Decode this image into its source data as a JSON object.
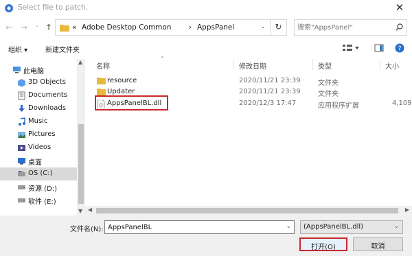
{
  "window": {
    "title": "Select file to patch.",
    "close_glyph": "✕"
  },
  "nav": {
    "back_glyph": "←",
    "forward_glyph": "→",
    "recent_glyph": "⌄",
    "up_glyph": "↑",
    "address": {
      "overflow": "«",
      "crumb1": "Adobe Desktop Common",
      "sep": "›",
      "crumb2": "AppsPanel",
      "dropdown_glyph": "⌄",
      "refresh_glyph": "↻"
    },
    "search_placeholder": "搜索\"AppsPanel\""
  },
  "toolbar": {
    "organize": "组织 ▾",
    "new_folder": "新建文件夹"
  },
  "sidebar": {
    "items": [
      {
        "label": "此电脑",
        "icon": "computer-icon"
      },
      {
        "label": "3D Objects",
        "icon": "3d-objects-icon"
      },
      {
        "label": "Documents",
        "icon": "documents-icon"
      },
      {
        "label": "Downloads",
        "icon": "downloads-icon"
      },
      {
        "label": "Music",
        "icon": "music-icon"
      },
      {
        "label": "Pictures",
        "icon": "pictures-icon"
      },
      {
        "label": "Videos",
        "icon": "videos-icon"
      },
      {
        "label": "桌面",
        "icon": "desktop-icon"
      },
      {
        "label": "OS (C:)",
        "icon": "drive-icon"
      },
      {
        "label": "资源 (D:)",
        "icon": "drive-icon"
      },
      {
        "label": "软件 (E:)",
        "icon": "drive-icon"
      }
    ]
  },
  "columns": {
    "name": "名称",
    "date": "修改日期",
    "type": "类型",
    "size": "大小"
  },
  "files": [
    {
      "name": "resource",
      "date": "2020/11/21 23:39",
      "type": "文件夹",
      "size": "",
      "icon": "folder-icon"
    },
    {
      "name": "Updater",
      "date": "2020/11/21 23:39",
      "type": "文件夹",
      "size": "",
      "icon": "folder-icon"
    },
    {
      "name": "AppsPanelBL.dll",
      "date": "2020/12/3 17:47",
      "type": "应用程序扩展",
      "size": "4,109",
      "icon": "dll-file-icon"
    }
  ],
  "bottom": {
    "filename_label": "文件名(N):",
    "filename_value": "AppsPanelBL",
    "filetype_value": "(AppsPanelBL.dll)",
    "open_label": "打开(O)",
    "cancel_label": "取消"
  },
  "colors": {
    "highlight": "#c9282d",
    "folder": "#e8b93c",
    "selected_bg": "#d9d9d9"
  }
}
